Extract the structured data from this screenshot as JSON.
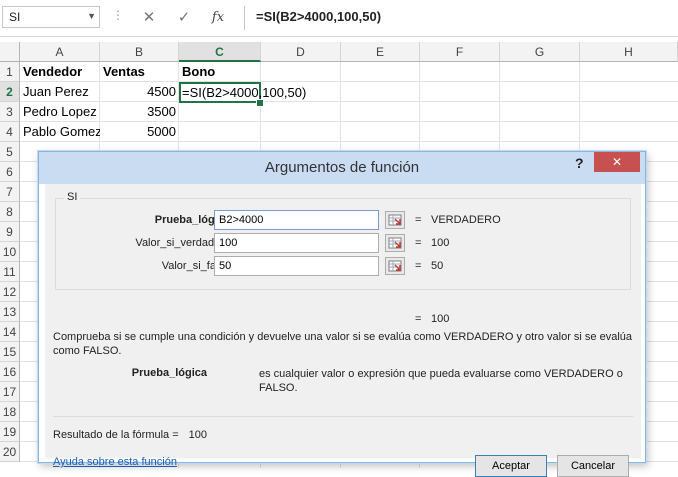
{
  "formula_bar": {
    "name_box": "SI",
    "cancel_symbol": "✕",
    "enter_symbol": "✓",
    "fx_symbol": "fx",
    "formula": "=SI(B2>4000,100,50)"
  },
  "columns": [
    "A",
    "B",
    "C",
    "D",
    "E",
    "F",
    "G",
    "H"
  ],
  "rows": [
    "1",
    "2",
    "3",
    "4",
    "5",
    "6",
    "7",
    "8",
    "9",
    "10",
    "11",
    "12",
    "13",
    "14",
    "15",
    "16",
    "17",
    "18",
    "19",
    "20"
  ],
  "cells": {
    "A1": "Vendedor",
    "B1": "Ventas",
    "C1": "Bono",
    "A2": "Juan Perez",
    "B2": "4500",
    "C2": "=SI(B2>4000,100,50)",
    "A3": "Pedro Lopez",
    "B3": "3500",
    "A4": "Pablo Gomez",
    "B4": "5000"
  },
  "dialog": {
    "title": "Argumentos de función",
    "help_symbol": "?",
    "close_symbol": "✕",
    "function_name": "SI",
    "args": [
      {
        "label": "Prueba_lógica",
        "value": "B2>4000",
        "result": "VERDADERO"
      },
      {
        "label": "Valor_si_verdadero",
        "value": "100",
        "result": "100"
      },
      {
        "label": "Valor_si_falso",
        "value": "50",
        "result": "50"
      }
    ],
    "eq": "=",
    "function_result": "100",
    "description": "Comprueba si se cumple una condición y devuelve una valor si se evalúa como VERDADERO y otro valor si se evalúa como FALSO.",
    "arg_desc_name": "Prueba_lógica",
    "arg_desc_text": "es cualquier valor o expresión que pueda evaluarse como VERDADERO o FALSO.",
    "formula_result_label": "Resultado de la fórmula =",
    "formula_result_value": "100",
    "help_link": "Ayuda sobre esta función",
    "ok_label": "Aceptar",
    "cancel_label": "Cancelar"
  },
  "colors": {
    "excel_green": "#217346",
    "title_bar": "#c9dcf2",
    "close_red": "#c75050",
    "link": "#1a5db4"
  },
  "icons": [
    "dropdown-icon",
    "cancel-icon",
    "enter-icon",
    "insert-function-icon",
    "help-icon",
    "close-icon",
    "range-select-icon"
  ]
}
